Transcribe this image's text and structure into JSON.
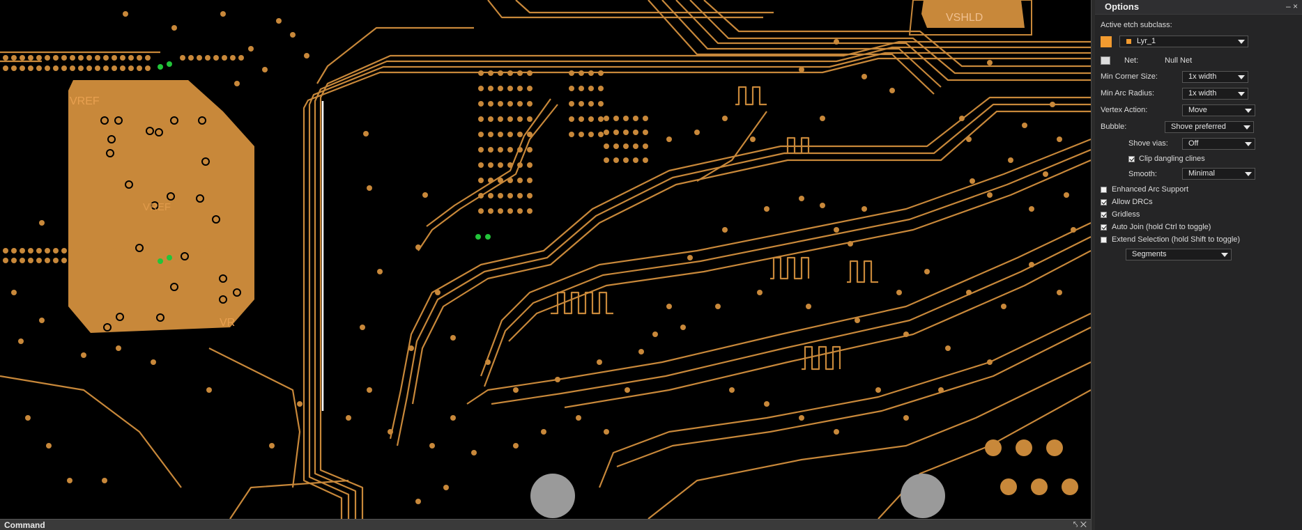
{
  "colors": {
    "copper": "#c8883a",
    "background": "#000000",
    "accent_swatch": "#f29b30",
    "via_green": "#22c43a",
    "panel_bg": "#252526"
  },
  "canvas": {
    "labels": [
      "VREF",
      "VREF",
      "VR",
      "VSHLD"
    ]
  },
  "command_bar": {
    "title": "Command",
    "controls": "⤣ ✕"
  },
  "options": {
    "title": "Options",
    "window_controls": "– ×",
    "active_etch_label": "Active etch subclass:",
    "layer_value": "Lyr_1",
    "net_label": "Net:",
    "net_value": "Null Net",
    "min_corner_label": "Min Corner Size:",
    "min_corner_value": "1x width",
    "min_arc_label": "Min Arc Radius:",
    "min_arc_value": "1x width",
    "vertex_label": "Vertex Action:",
    "vertex_value": "Move",
    "bubble_label": "Bubble:",
    "bubble_value": "Shove preferred",
    "shove_vias_label": "Shove vias:",
    "shove_vias_value": "Off",
    "clip_label": "Clip dangling clines",
    "clip_checked": true,
    "smooth_label": "Smooth:",
    "smooth_value": "Minimal",
    "checkboxes": [
      {
        "label": "Enhanced Arc Support",
        "checked": false
      },
      {
        "label": "Allow DRCs",
        "checked": true
      },
      {
        "label": "Gridless",
        "checked": true
      },
      {
        "label": "Auto Join (hold Ctrl to toggle)",
        "checked": true
      },
      {
        "label": "Extend Selection (hold Shift to toggle)",
        "checked": false
      }
    ],
    "extend_mode_value": "Segments"
  }
}
